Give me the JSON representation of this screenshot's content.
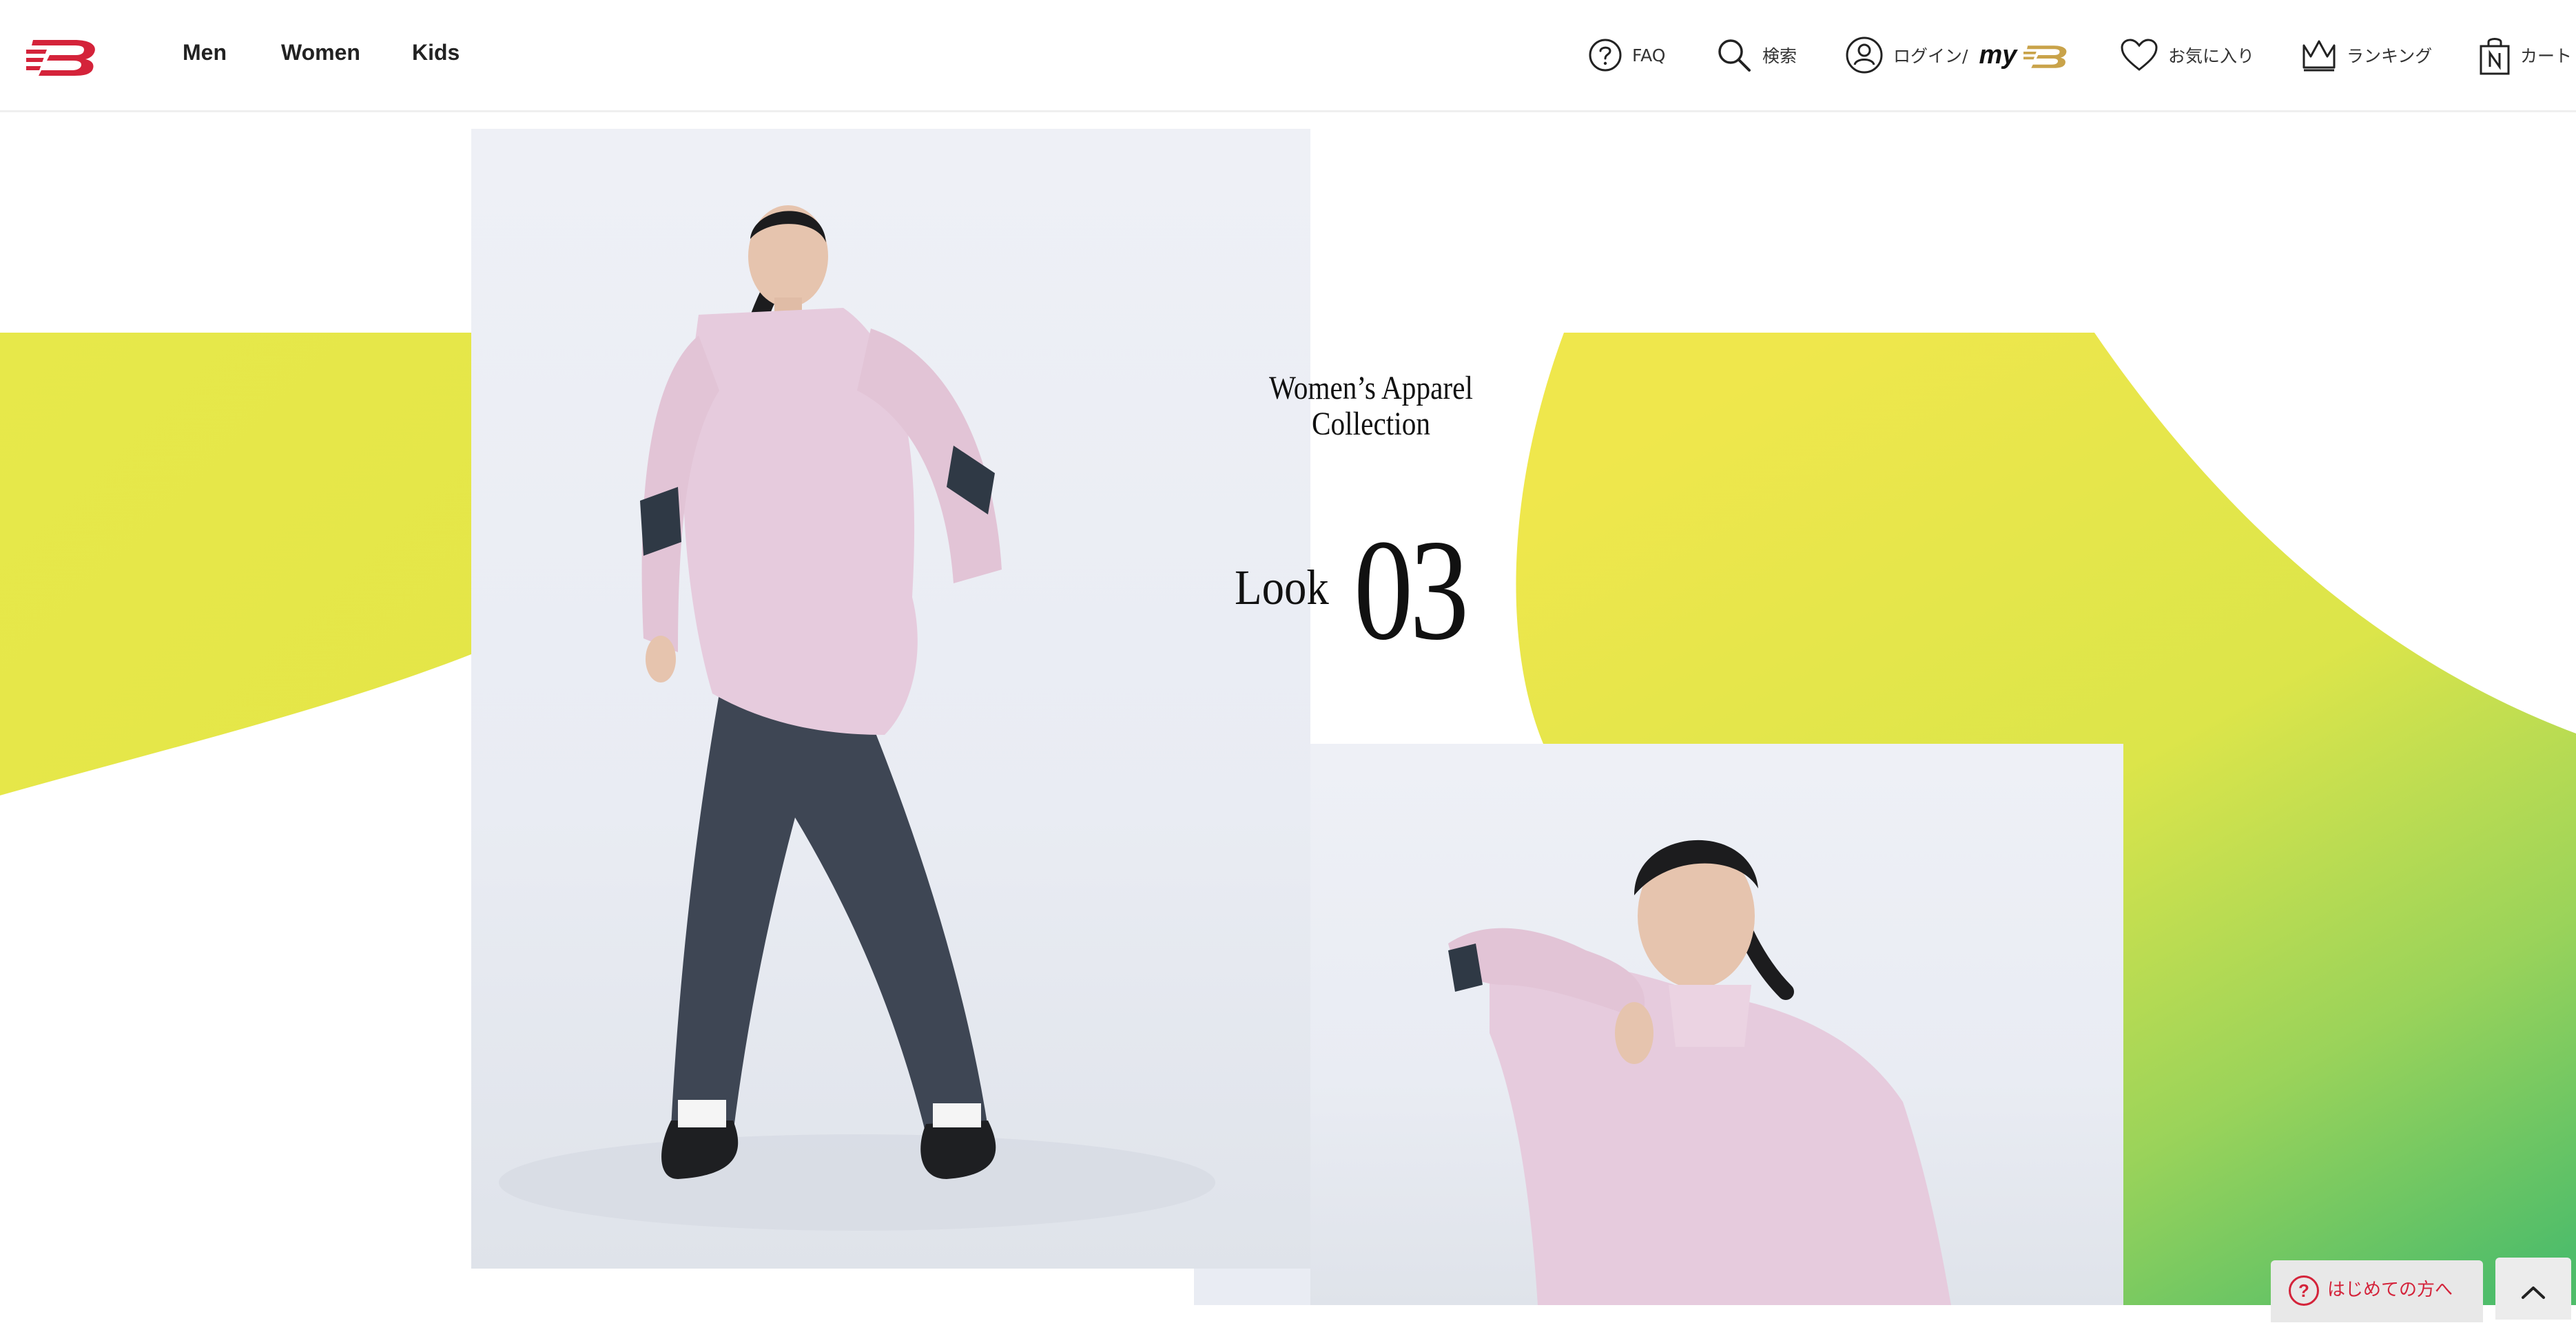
{
  "header": {
    "logo_icon": "new-balance-logo-icon",
    "nav": [
      {
        "label": "Men"
      },
      {
        "label": "Women"
      },
      {
        "label": "Kids"
      }
    ],
    "utilities": {
      "faq": {
        "label": "FAQ",
        "icon": "question-circle-icon"
      },
      "search": {
        "label": "検索",
        "icon": "search-icon"
      },
      "login": {
        "label": "ログイン/",
        "brand_text": "my",
        "icon": "user-circle-icon"
      },
      "favorites": {
        "label": "お気に入り",
        "icon": "heart-icon"
      },
      "ranking": {
        "label": "ランキング",
        "icon": "crown-icon"
      },
      "cart": {
        "label": "カート",
        "icon": "shopping-bag-icon"
      }
    }
  },
  "feature": {
    "collection_line1": "Women’s Apparel",
    "collection_line2": "Collection",
    "look_word": "Look",
    "look_number": "03"
  },
  "floating": {
    "first_time_label": "はじめての方へ",
    "first_time_icon": "question-circle-icon",
    "back_to_top_icon": "chevron-up-icon"
  },
  "colors": {
    "brand_red": "#d4233a",
    "accent_yellow": "#ece84b",
    "accent_green": "#5cbf6a",
    "brand_gold": "#c9a34a"
  }
}
